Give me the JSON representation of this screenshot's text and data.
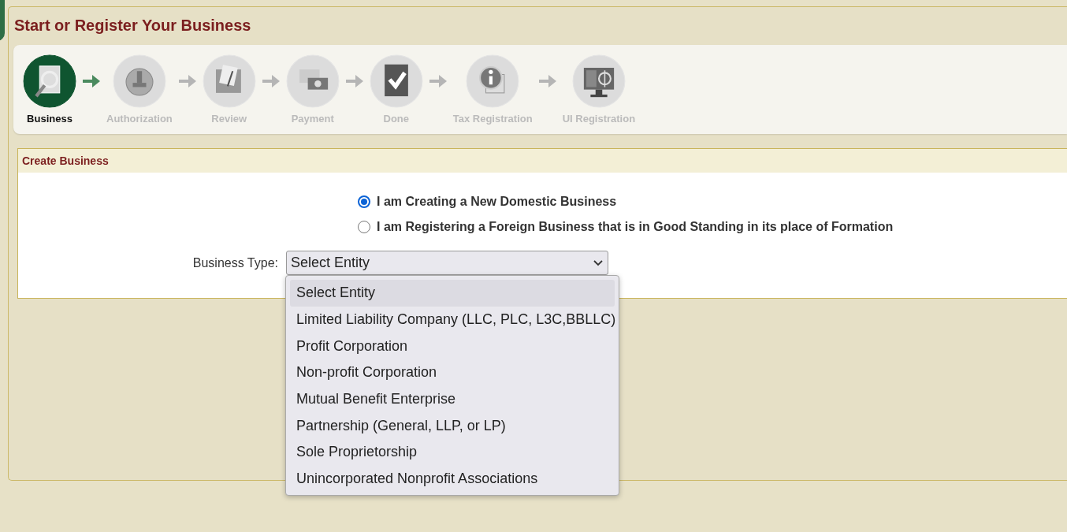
{
  "page": {
    "title": "Start or Register Your Business"
  },
  "steps": [
    {
      "label": "Business",
      "selected": true
    },
    {
      "label": "Authorization",
      "selected": false
    },
    {
      "label": "Review",
      "selected": false
    },
    {
      "label": "Payment",
      "selected": false
    },
    {
      "label": "Done",
      "selected": false
    },
    {
      "label": "Tax Registration",
      "selected": false
    },
    {
      "label": "UI Registration",
      "selected": false
    }
  ],
  "section": {
    "title": "Create Business",
    "options": [
      {
        "label": "I am Creating a New Domestic Business",
        "selected": true
      },
      {
        "label": "I am Registering a Foreign Business that is in Good Standing in its place of Formation",
        "selected": false
      }
    ],
    "business_type": {
      "label": "Business Type:",
      "value": "Select Entity",
      "expanded": true,
      "options": [
        {
          "label": "Select Entity",
          "selected": true
        },
        {
          "label": "Limited Liability Company (LLC, PLC, L3C,BBLLC)",
          "selected": false
        },
        {
          "label": "Profit Corporation",
          "selected": false
        },
        {
          "label": "Non-profit Corporation",
          "selected": false
        },
        {
          "label": "Mutual Benefit Enterprise",
          "selected": false
        },
        {
          "label": "Partnership (General, LLP, or LP)",
          "selected": false
        },
        {
          "label": "Sole Proprietorship",
          "selected": false
        },
        {
          "label": "Unincorporated Nonprofit Associations",
          "selected": false
        }
      ]
    }
  }
}
